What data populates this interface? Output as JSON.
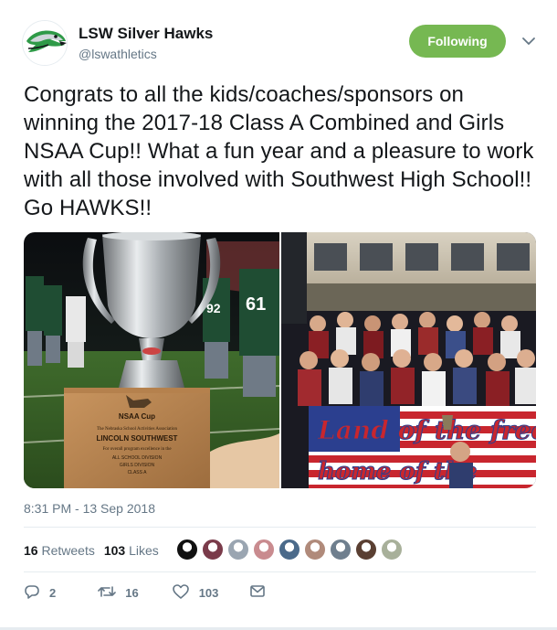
{
  "user": {
    "display_name": "LSW Silver Hawks",
    "handle": "@lswathletics",
    "avatar_icon": "hawk-logo-icon",
    "brand_color": "#2e9a47"
  },
  "follow_button": {
    "label": "Following",
    "color": "#76b852"
  },
  "tweet": {
    "text": "Congrats to all the kids/coaches/sponsors on winning the 2017-18 Class A Combined and Girls NSAA Cup!!  What a fun year and a pleasure to work with all those involved with Southwest High School!! Go HAWKS!!",
    "timestamp": "8:31 PM - 13 Sep 2018"
  },
  "media": {
    "photos": [
      {
        "name": "trophy-photo",
        "plaque_lines": [
          "NSAA Cup",
          "The Nebraska School Activities Association",
          "LINCOLN SOUTHWEST",
          "For overall program excellence in the",
          "ALL SCHOOL DIVISION",
          "GIRLS DIVISION",
          "CLASS A"
        ],
        "jersey_numbers": [
          "61",
          "92"
        ]
      },
      {
        "name": "student-section-photo",
        "banner_lines": [
          "Land of the free",
          "home of the"
        ]
      }
    ]
  },
  "stats": {
    "retweets_count": "16",
    "retweets_label": "Retweets",
    "likes_count": "103",
    "likes_label": "Likes"
  },
  "likers": [
    {
      "name": "liker-avatar-1",
      "color": "#111111"
    },
    {
      "name": "liker-avatar-2",
      "color": "#7a3b4a"
    },
    {
      "name": "liker-avatar-3",
      "color": "#9aa5b1"
    },
    {
      "name": "liker-avatar-4",
      "color": "#c98b8f"
    },
    {
      "name": "liker-avatar-5",
      "color": "#4b6a8a"
    },
    {
      "name": "liker-avatar-6",
      "color": "#b08a7a"
    },
    {
      "name": "liker-avatar-7",
      "color": "#6f7f8e"
    },
    {
      "name": "liker-avatar-8",
      "color": "#5a3f32"
    },
    {
      "name": "liker-avatar-9",
      "color": "#a8b09a"
    }
  ],
  "actions": {
    "reply_count": "2",
    "retweet_count": "16",
    "like_count": "103",
    "reply_icon": "reply-icon",
    "retweet_icon": "retweet-icon",
    "like_icon": "heart-icon",
    "dm_icon": "envelope-icon"
  }
}
